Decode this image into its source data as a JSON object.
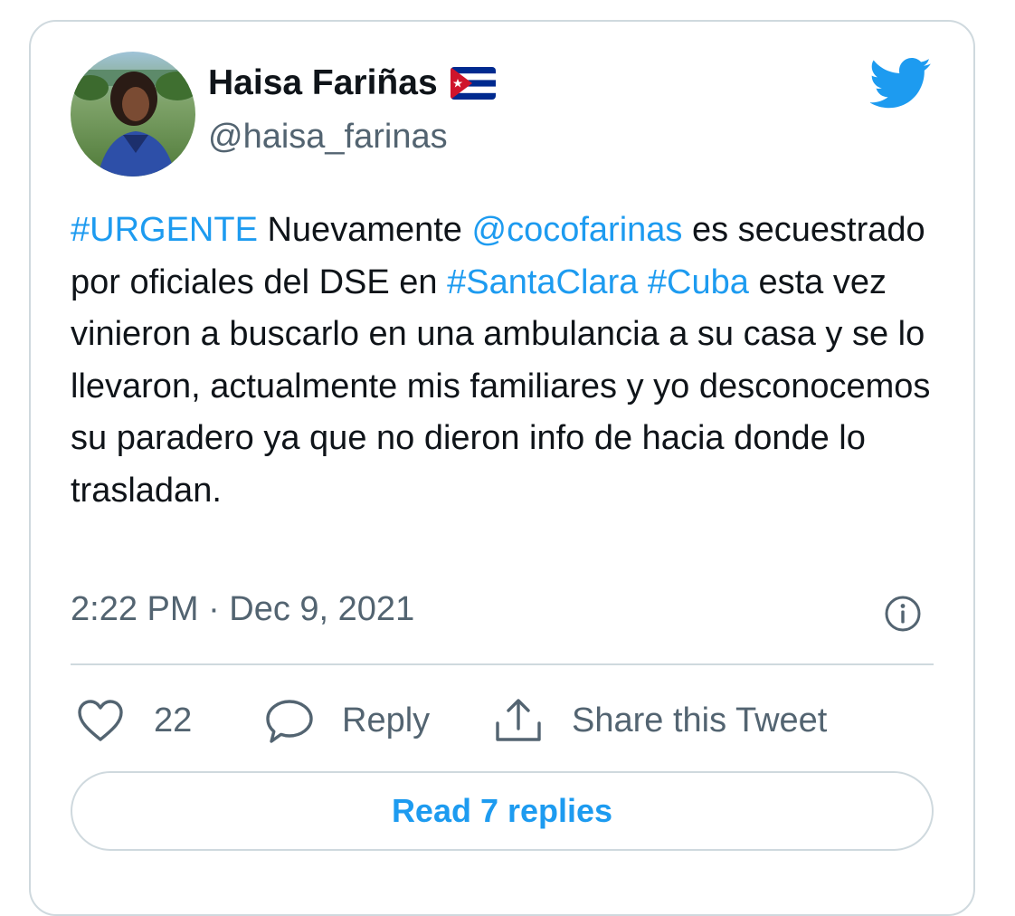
{
  "user": {
    "display_name": "Haisa Fariñas",
    "handle": "@haisa_farinas",
    "flag_icon": "cuba-flag-icon"
  },
  "tweet": {
    "segments": [
      {
        "text": "#URGENTE",
        "type": "hashtag"
      },
      {
        "text": " Nuevamente ",
        "type": "text"
      },
      {
        "text": "@cocofarinas",
        "type": "mention"
      },
      {
        "text": " es secuestrado por oficiales del DSE en ",
        "type": "text"
      },
      {
        "text": "#SantaClara",
        "type": "hashtag"
      },
      {
        "text": " ",
        "type": "text"
      },
      {
        "text": "#Cuba",
        "type": "hashtag"
      },
      {
        "text": " esta vez vinieron a buscarlo en una ambulancia a su casa y se lo llevaron, actualmente mis familiares y yo desconocemos su paradero ya que no dieron info de hacia donde lo trasladan.",
        "type": "text"
      }
    ],
    "timestamp": "2:22 PM · Dec 9, 2021"
  },
  "actions": {
    "like_count": "22",
    "reply_label": "Reply",
    "share_label": "Share this Tweet"
  },
  "read_replies_label": "Read 7 replies",
  "colors": {
    "accent": "#1d9bf0",
    "text": "#0f1419",
    "secondary": "#536471",
    "border": "#cfd9de"
  },
  "icons": [
    "twitter-bird-icon",
    "info-icon",
    "heart-icon",
    "reply-bubble-icon",
    "share-icon"
  ]
}
